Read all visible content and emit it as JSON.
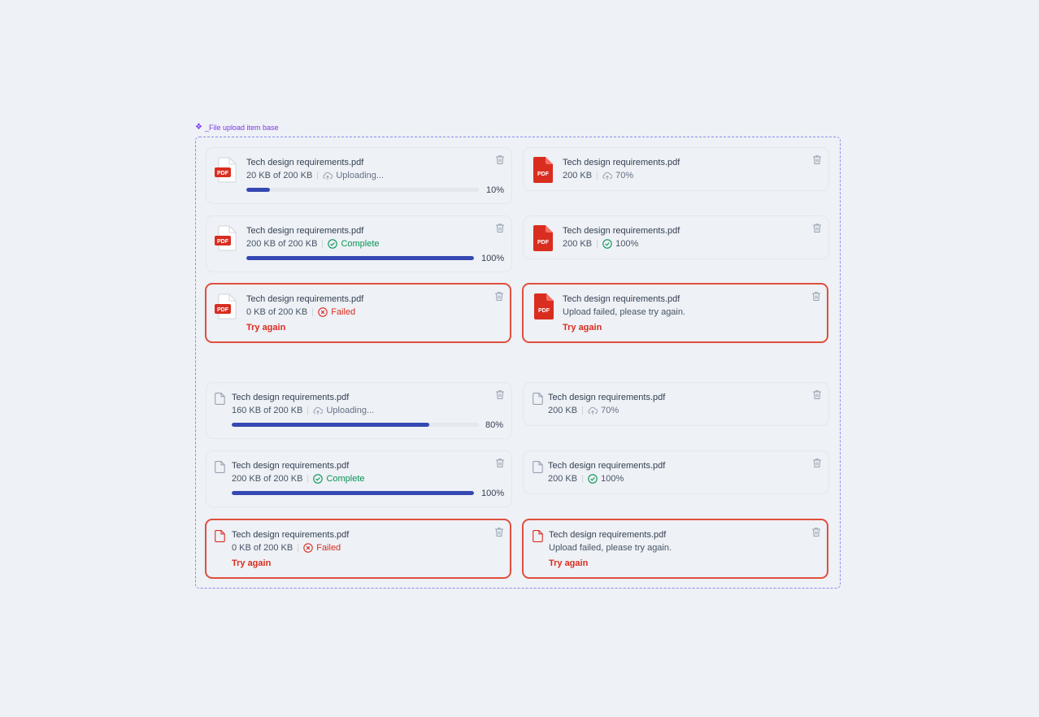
{
  "component_label": "_File upload item base",
  "colors": {
    "accent": "#3449b2",
    "success": "#079455",
    "error": "#d92d20",
    "pdf": "#d92d20"
  },
  "icons": {
    "pdf": "pdf-file-icon",
    "generic": "file-icon",
    "delete": "trash-icon",
    "upload": "cloud-upload-icon",
    "check": "check-circle-icon",
    "failed": "x-circle-icon"
  },
  "cards": [
    {
      "file_name": "Tech design requirements.pdf",
      "size_text": "20 KB of 200 KB",
      "status": "Uploading...",
      "progress": 0.1,
      "progress_label": "10%"
    },
    {
      "file_name": "Tech design requirements.pdf",
      "size_text": "200 KB",
      "status": "70%"
    },
    {
      "file_name": "Tech design requirements.pdf",
      "size_text": "200 KB of 200 KB",
      "status": "Complete",
      "progress": 1.0,
      "progress_label": "100%"
    },
    {
      "file_name": "Tech design requirements.pdf",
      "size_text": "200 KB",
      "status": "100%"
    },
    {
      "file_name": "Tech design requirements.pdf",
      "size_text": "0 KB of 200 KB",
      "status": "Failed",
      "action": "Try again"
    },
    {
      "file_name": "Tech design requirements.pdf",
      "size_text": "Upload failed, please try again.",
      "action": "Try again"
    },
    {
      "file_name": "Tech design requirements.pdf",
      "size_text": "160 KB of 200 KB",
      "status": "Uploading...",
      "progress": 0.8,
      "progress_label": "80%"
    },
    {
      "file_name": "Tech design requirements.pdf",
      "size_text": "200 KB",
      "status": "70%"
    },
    {
      "file_name": "Tech design requirements.pdf",
      "size_text": "200 KB of 200 KB",
      "status": "Complete",
      "progress": 1.0,
      "progress_label": "100%"
    },
    {
      "file_name": "Tech design requirements.pdf",
      "size_text": "200 KB",
      "status": "100%"
    },
    {
      "file_name": "Tech design requirements.pdf",
      "size_text": "0 KB of 200 KB",
      "status": "Failed",
      "action": "Try again"
    },
    {
      "file_name": "Tech design requirements.pdf",
      "size_text": "Upload failed, please try again.",
      "action": "Try again"
    }
  ],
  "pdf_badge": "PDF"
}
